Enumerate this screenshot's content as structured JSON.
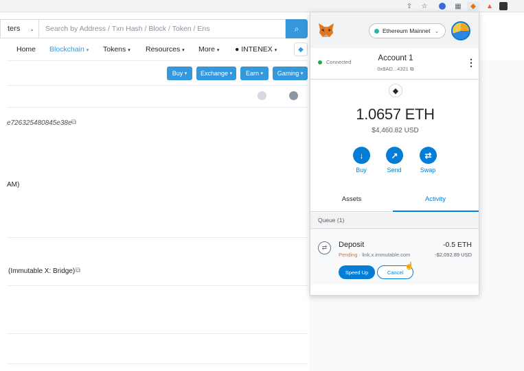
{
  "browser": {
    "icons": [
      "share-icon",
      "star-icon",
      "extension-icon",
      "reader-icon",
      "metamask-fox-icon",
      "brave-icon",
      "menu-icon"
    ]
  },
  "etherscan": {
    "filter_label": "ters",
    "search_placeholder": "Search by Address / Txn Hash / Block / Token / Ens",
    "nav": {
      "home": "Home",
      "blockchain": "Blockchain",
      "tokens": "Tokens",
      "resources": "Resources",
      "more": "More",
      "user": "INTENEX"
    },
    "buttons": {
      "buy": "Buy",
      "exchange": "Exchange",
      "earn": "Earn",
      "gaming": "Gaming"
    },
    "rows": {
      "hash_fragment": "e726325480845e38e",
      "time_fragment": "AM)",
      "bridge_label": "(Immutable X: Bridge)"
    }
  },
  "metamask": {
    "network": "Ethereum Mainnet",
    "connection_status": "Connected",
    "account_name": "Account 1",
    "account_address": "0x8AD...4321",
    "balance": "1.0657 ETH",
    "balance_usd": "$4,460.82 USD",
    "actions": {
      "buy": "Buy",
      "send": "Send",
      "swap": "Swap"
    },
    "tabs": {
      "assets": "Assets",
      "activity": "Activity"
    },
    "queue_label": "Queue (1)",
    "transaction": {
      "title": "Deposit",
      "status": "Pending",
      "origin": "link.x.immutable.com",
      "amount": "-0.5 ETH",
      "amount_usd": "-$2,092.89 USD",
      "speed_up": "Speed Up",
      "cancel": "Cancel"
    },
    "colors": {
      "accent": "#037dd6",
      "pending": "#f66a0a",
      "network_dot": "#29b6af"
    }
  }
}
